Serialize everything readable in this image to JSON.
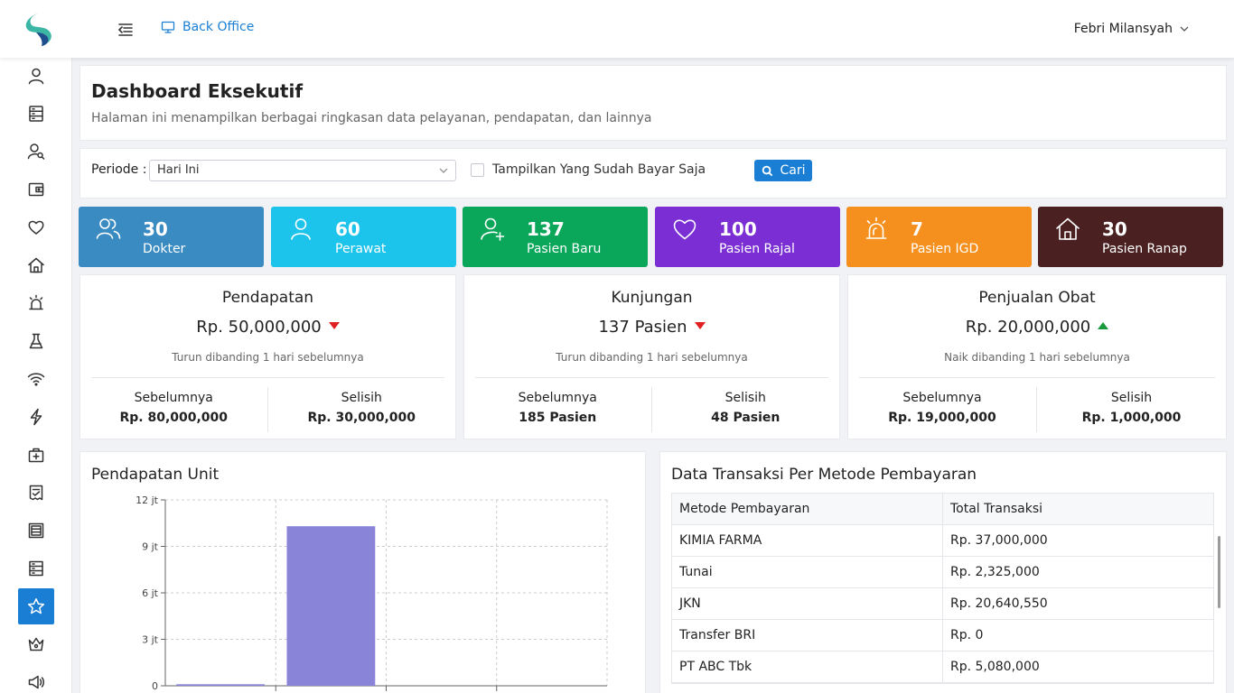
{
  "header": {
    "breadcrumb": "Back Office",
    "user_name": "Febri Milansyah",
    "brand_colors": {
      "teal": "#3bb5a4",
      "navy": "#1f4e8c"
    }
  },
  "sidebar": {
    "items": [
      {
        "icon": "user-icon",
        "active": false
      },
      {
        "icon": "server-icon",
        "active": false
      },
      {
        "icon": "user-search-icon",
        "active": false
      },
      {
        "icon": "wallet-icon",
        "active": false
      },
      {
        "icon": "heart-icon",
        "active": false
      },
      {
        "icon": "home-icon",
        "active": false
      },
      {
        "icon": "alarm-icon",
        "active": false
      },
      {
        "icon": "flask-icon",
        "active": false
      },
      {
        "icon": "wifi-icon",
        "active": false
      },
      {
        "icon": "lightning-icon",
        "active": false
      },
      {
        "icon": "first-aid-icon",
        "active": false
      },
      {
        "icon": "receipt-icon",
        "active": false
      },
      {
        "icon": "building-icon",
        "active": false
      },
      {
        "icon": "storage-icon",
        "active": false
      },
      {
        "icon": "star-icon",
        "active": true
      },
      {
        "icon": "crown-icon",
        "active": false
      },
      {
        "icon": "megaphone-icon",
        "active": false
      }
    ],
    "active_color": "#1a7fd4"
  },
  "page": {
    "title": "Dashboard Eksekutif",
    "subtitle": "Halaman ini menampilkan berbagai ringkasan data pelayanan, pendapatan, dan lainnya"
  },
  "filter": {
    "periode_label": "Periode :",
    "periode_value": "Hari Ini",
    "checkbox_label": "Tampilkan Yang Sudah Bayar Saja",
    "checkbox_checked": false,
    "search_label": "Cari"
  },
  "stats": [
    {
      "value": "30",
      "label": "Dokter",
      "color": "#3a8bc2",
      "icon": "users-icon"
    },
    {
      "value": "60",
      "label": "Perawat",
      "color": "#1cc3ea",
      "icon": "user-icon"
    },
    {
      "value": "137",
      "label": "Pasien Baru",
      "color": "#0aa65a",
      "icon": "user-plus-icon"
    },
    {
      "value": "100",
      "label": "Pasien Rajal",
      "color": "#7b2ed3",
      "icon": "heart-icon"
    },
    {
      "value": "7",
      "label": "Pasien IGD",
      "color": "#f5901e",
      "icon": "alarm-icon"
    },
    {
      "value": "30",
      "label": "Pasien Ranap",
      "color": "#4a2020",
      "icon": "home-icon"
    }
  ],
  "summaries": [
    {
      "title": "Pendapatan",
      "value": "Rp. 50,000,000",
      "trend": "down",
      "note": "Turun dibanding 1 hari sebelumnya",
      "prev_label": "Sebelumnya",
      "prev_value": "Rp. 80,000,000",
      "diff_label": "Selisih",
      "diff_value": "Rp. 30,000,000"
    },
    {
      "title": "Kunjungan",
      "value": "137 Pasien",
      "trend": "down",
      "note": "Turun dibanding 1 hari sebelumnya",
      "prev_label": "Sebelumnya",
      "prev_value": "185 Pasien",
      "diff_label": "Selisih",
      "diff_value": "48 Pasien"
    },
    {
      "title": "Penjualan Obat",
      "value": "Rp. 20,000,000",
      "trend": "up",
      "note": "Naik dibanding 1 hari sebelumnya",
      "prev_label": "Sebelumnya",
      "prev_value": "Rp. 19,000,000",
      "diff_label": "Selisih",
      "diff_value": "Rp. 1,000,000"
    }
  ],
  "chart_panel": {
    "title": "Pendapatan Unit"
  },
  "chart_data": {
    "type": "bar",
    "title": "Pendapatan Unit",
    "xlabel": "",
    "ylabel": "",
    "ylim": [
      0,
      12
    ],
    "y_unit": "jt",
    "yticks": [
      {
        "value": 0,
        "label": "0"
      },
      {
        "value": 3,
        "label": "3 jt"
      },
      {
        "value": 6,
        "label": "6 jt"
      },
      {
        "value": 9,
        "label": "9 jt"
      },
      {
        "value": 12,
        "label": "12 jt"
      }
    ],
    "values": [
      0.1,
      10.3,
      0,
      0
    ],
    "bar_color": "#8984d8",
    "grid": true
  },
  "table_panel": {
    "title": "Data Transaksi Per Metode Pembayaran",
    "columns": [
      "Metode Pembayaran",
      "Total Transaksi"
    ],
    "rows": [
      [
        "KIMIA FARMA",
        "Rp. 37,000,000"
      ],
      [
        "Tunai",
        "Rp. 2,325,000"
      ],
      [
        "JKN",
        "Rp. 20,640,550"
      ],
      [
        "Transfer BRI",
        "Rp. 0"
      ],
      [
        "PT ABC Tbk",
        "Rp. 5,080,000"
      ]
    ]
  }
}
